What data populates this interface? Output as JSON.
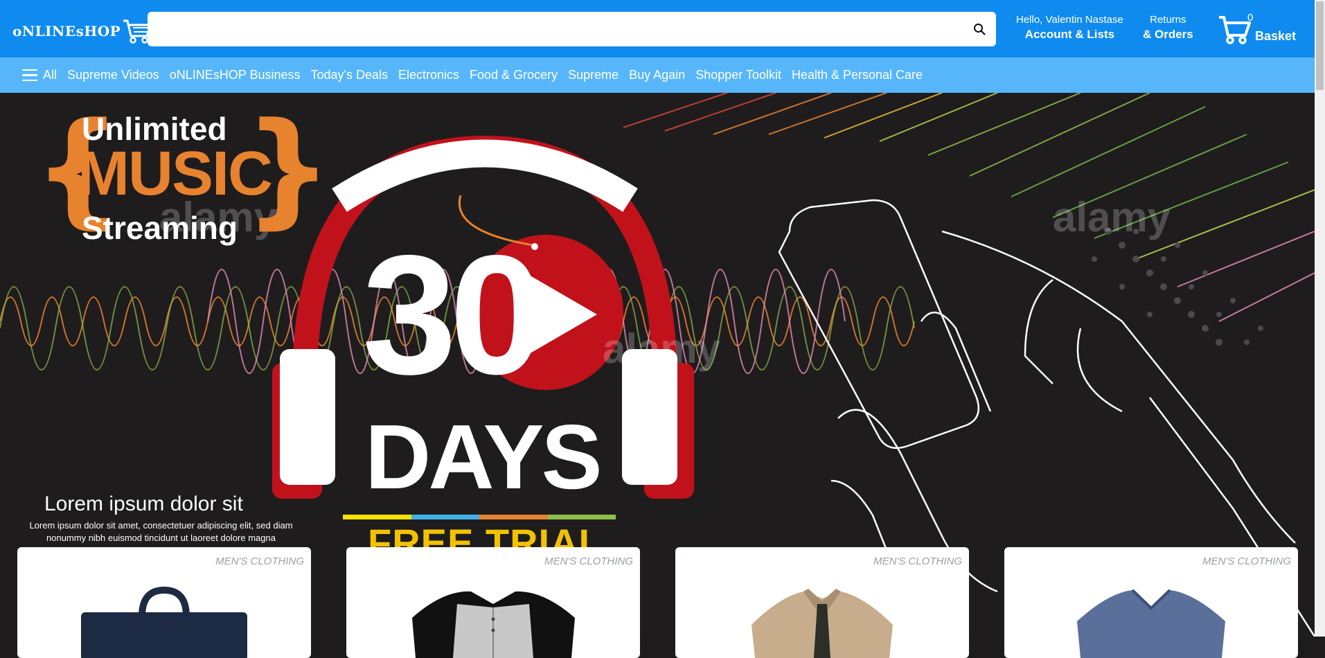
{
  "header": {
    "logo_text": "oNLINEsHOP",
    "search_placeholder": "",
    "greeting": "Hello, Valentin Nastase",
    "account_label": "Account & Lists",
    "returns_top": "Returns",
    "returns_bottom": "& Orders",
    "basket_count": "0",
    "basket_label": "Basket"
  },
  "nav": {
    "all_label": "All",
    "items": [
      "Supreme Videos",
      "oNLINEsHOP Business",
      "Today's Deals",
      "Electronics",
      "Food & Grocery",
      "Supreme",
      "Buy Again",
      "Shopper Toolkit",
      "Health & Personal Care"
    ]
  },
  "hero": {
    "unlimited": "Unlimited",
    "music": "MUSIC",
    "streaming": "Streaming",
    "thirty": "30",
    "days": "DAYS",
    "free_trial": "FREE TRIAL",
    "lorem_heading": "Lorem ipsum dolor sit",
    "lorem_body": "Lorem ipsum dolor sit amet, consectetuer adipiscing elit, sed diam nonummy nibh euismod tincidunt ut laoreet dolore magna"
  },
  "products": [
    {
      "category": "MEN'S CLOTHING",
      "icon": "bag-icon"
    },
    {
      "category": "MEN'S CLOTHING",
      "icon": "shirt-icon"
    },
    {
      "category": "MEN'S CLOTHING",
      "icon": "jacket-icon"
    },
    {
      "category": "MEN'S CLOTHING",
      "icon": "tshirt-icon"
    }
  ],
  "colors": {
    "header_bg": "#0f8bf0",
    "nav_bg": "#57b6fa",
    "hero_bg": "#1f1c1d",
    "accent_orange": "#e7822f",
    "headphone_red": "#c1121c"
  }
}
